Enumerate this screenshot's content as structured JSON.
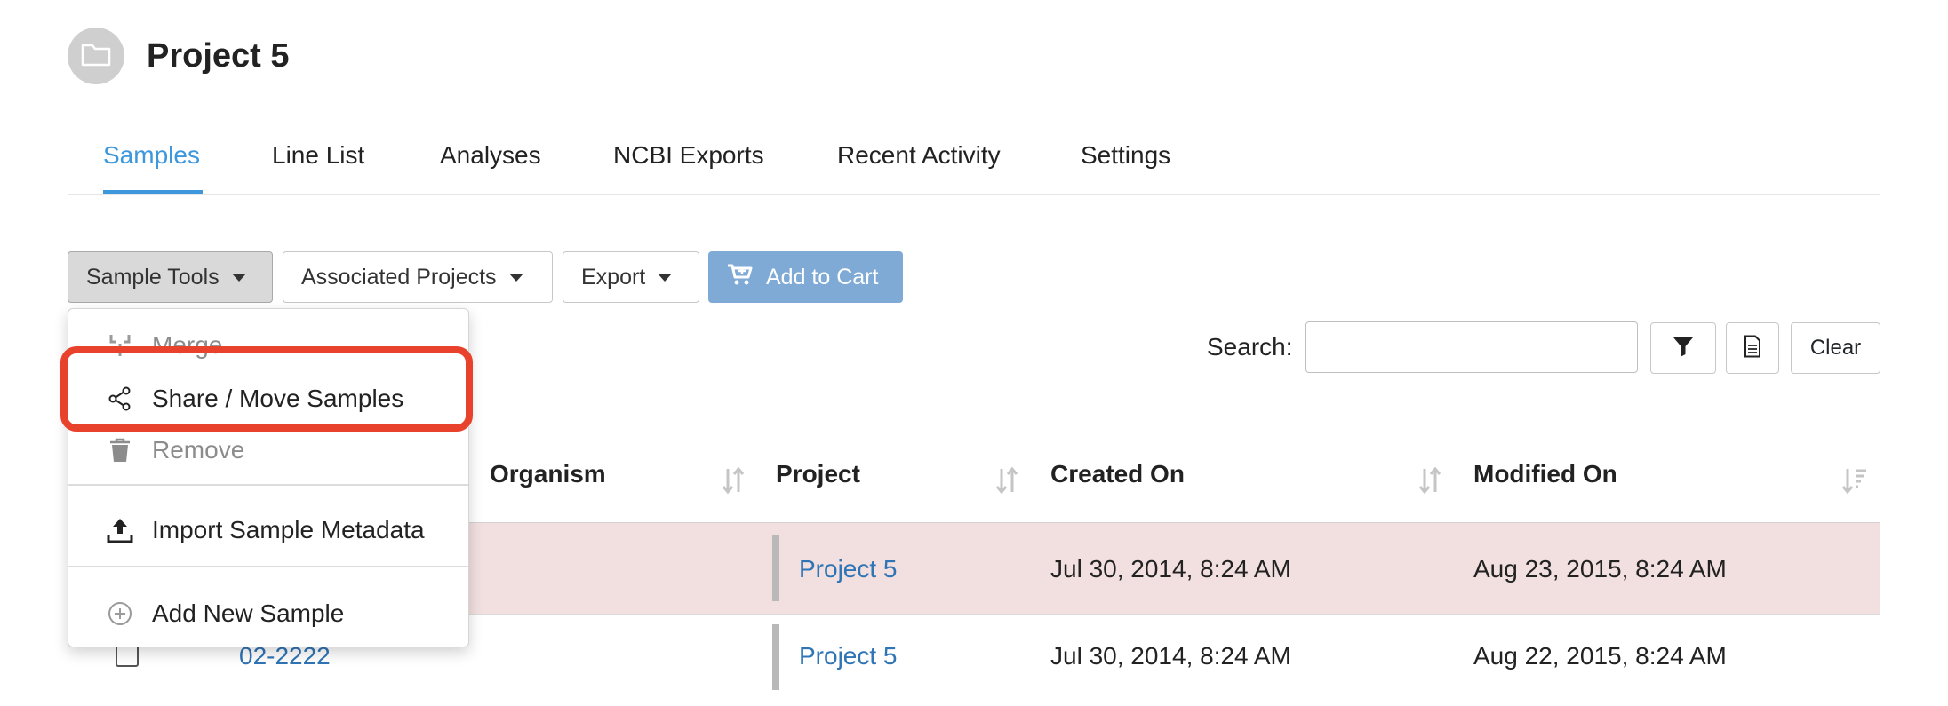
{
  "project": {
    "title": "Project 5",
    "avatar_icon": "folder-icon"
  },
  "tabs": [
    {
      "label": "Samples",
      "active": true
    },
    {
      "label": "Line List"
    },
    {
      "label": "Analyses"
    },
    {
      "label": "NCBI Exports"
    },
    {
      "label": "Recent Activity"
    },
    {
      "label": "Settings"
    }
  ],
  "toolbar": {
    "sample_tools": "Sample Tools",
    "associated_projects": "Associated Projects",
    "export": "Export",
    "add_to_cart": "Add to Cart"
  },
  "search": {
    "label": "Search:",
    "value": "",
    "clear_label": "Clear"
  },
  "sample_tools_menu": {
    "merge": "Merge",
    "share_move": "Share / Move Samples",
    "remove": "Remove",
    "import_metadata": "Import Sample Metadata",
    "add_new": "Add New Sample"
  },
  "table": {
    "columns": {
      "organism": "Organism",
      "project": "Project",
      "created": "Created On",
      "modified": "Modified On"
    },
    "rows": [
      {
        "name": "",
        "project": "Project 5",
        "created": "Jul 30, 2014, 8:24 AM",
        "modified": "Aug 23, 2015, 8:24 AM",
        "selected": true
      },
      {
        "name": "02-2222",
        "project": "Project 5",
        "created": "Jul 30, 2014, 8:24 AM",
        "modified": "Aug 22, 2015, 8:24 AM",
        "selected": false
      }
    ]
  },
  "colors": {
    "accent": "#3d97dc",
    "link": "#2f74b5",
    "selected_row": "#f2dfdf",
    "highlight": "#e8412c",
    "primary_button": "#7eaad5"
  }
}
